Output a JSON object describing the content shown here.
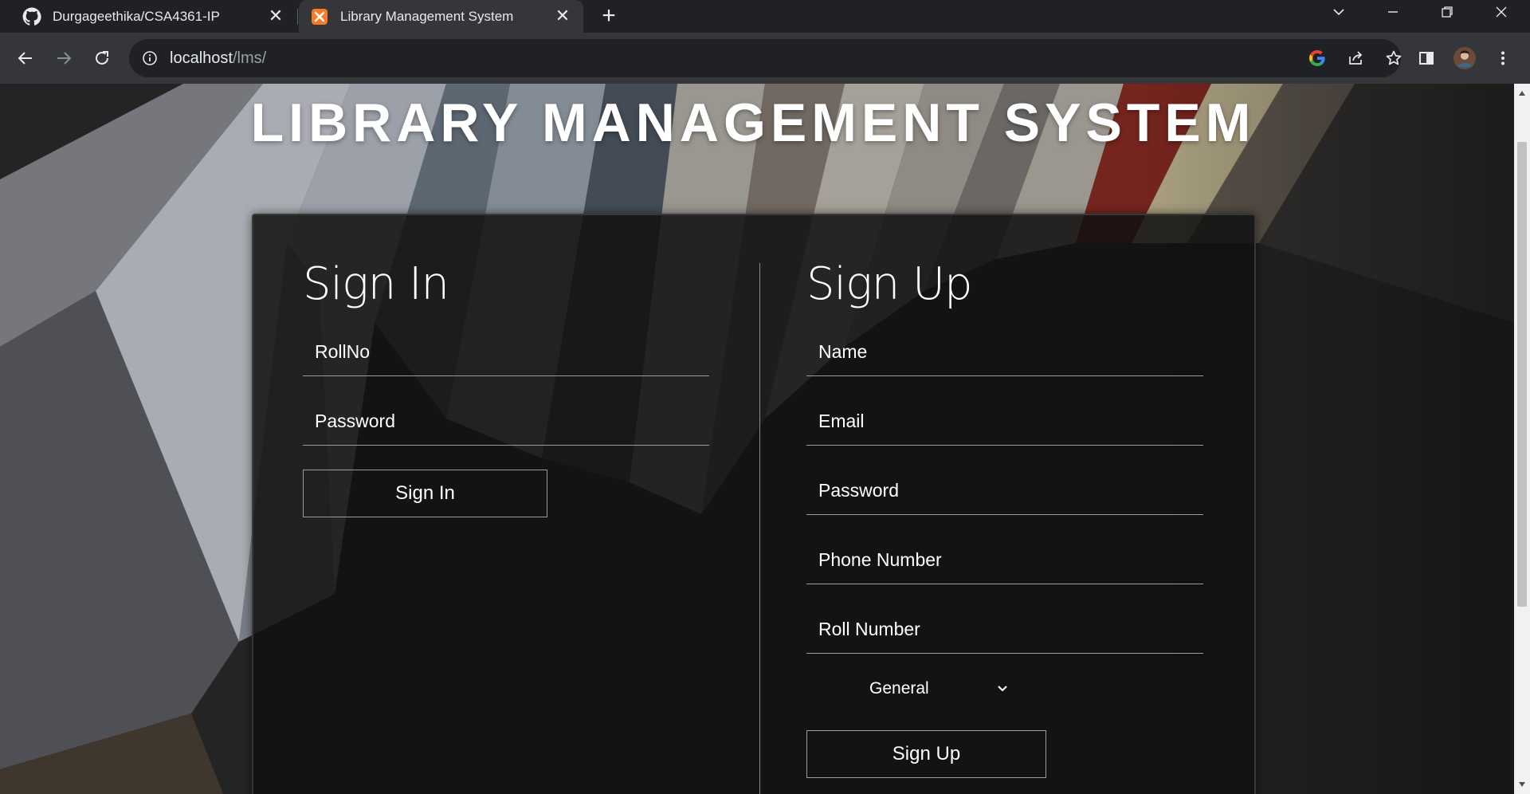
{
  "browser": {
    "tabs": [
      {
        "title": "Durgageethika/CSA4361-IP",
        "icon": "github-icon",
        "active": false
      },
      {
        "title": "Library Management System",
        "icon": "xampp-icon",
        "active": true
      }
    ],
    "new_tab_label": "+",
    "address": {
      "host": "localhost",
      "path": "/lms/"
    }
  },
  "page": {
    "title": "LIBRARY MANAGEMENT SYSTEM",
    "signin": {
      "heading": "Sign In",
      "rollno_placeholder": "RollNo",
      "password_placeholder": "Password",
      "button": "Sign In"
    },
    "signup": {
      "heading": "Sign Up",
      "name_placeholder": "Name",
      "email_placeholder": "Email",
      "password_placeholder": "Password",
      "phone_placeholder": "Phone Number",
      "roll_placeholder": "Roll Number",
      "category_selected": "General",
      "button": "Sign Up"
    }
  },
  "colors": {
    "chrome_dark": "#202124",
    "chrome_toolbar": "#35363a",
    "panel_bg": "#101010",
    "text": "#ffffff"
  }
}
